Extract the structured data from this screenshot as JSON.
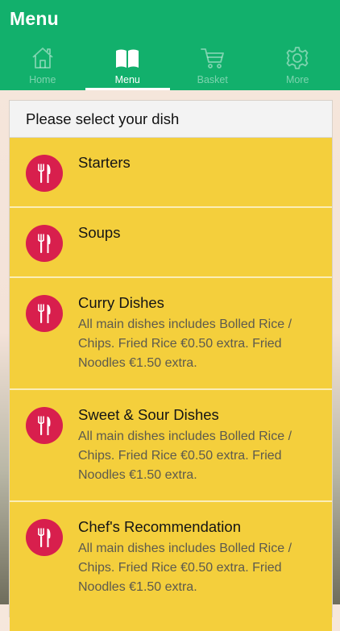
{
  "app": {
    "title": "Menu"
  },
  "tabs": [
    {
      "label": "Home",
      "icon": "home-icon",
      "active": false
    },
    {
      "label": "Menu",
      "icon": "book-icon",
      "active": true
    },
    {
      "label": "Basket",
      "icon": "cart-icon",
      "active": false
    },
    {
      "label": "More",
      "icon": "gear-icon",
      "active": false
    }
  ],
  "menu": {
    "header": "Please select your dish",
    "items": [
      {
        "name": "Starters",
        "description": ""
      },
      {
        "name": "Soups",
        "description": ""
      },
      {
        "name": "Curry Dishes",
        "description": "All main dishes includes Bolled Rice / Chips. Fried Rice €0.50 extra. Fried Noodles €1.50 extra."
      },
      {
        "name": "Sweet & Sour Dishes",
        "description": "All main dishes includes Bolled Rice / Chips. Fried Rice €0.50 extra. Fried Noodles €1.50 extra."
      },
      {
        "name": "Chef's Recommendation",
        "description": "All main dishes includes Bolled Rice / Chips. Fried Rice €0.50 extra. Fried Noodles €1.50 extra."
      }
    ]
  },
  "colors": {
    "appbar": "#12b06c",
    "item_background": "#f4cf3c",
    "badge": "#d81f4d"
  }
}
